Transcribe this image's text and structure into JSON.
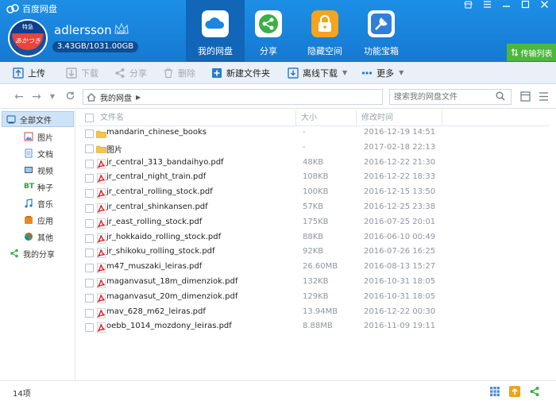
{
  "window": {
    "title": "百度网盘",
    "controls": [
      "skin-icon",
      "menu-icon",
      "minimize-icon",
      "maximize-icon",
      "close-icon"
    ]
  },
  "user": {
    "name": "adlersson",
    "badge": "VIP",
    "quota": "3.43GB/1031.00GB",
    "avatar_text_top": "特急",
    "avatar_text": "あかつき"
  },
  "nav_tabs": [
    {
      "label": "我的网盘",
      "icon": "cloud-icon",
      "active": true
    },
    {
      "label": "分享",
      "icon": "share-icon",
      "active": false
    },
    {
      "label": "隐藏空间",
      "icon": "lock-icon",
      "active": false
    },
    {
      "label": "功能宝箱",
      "icon": "tools-icon",
      "active": false
    }
  ],
  "transfer": {
    "label": "传输列表",
    "icon": "transfer-icon"
  },
  "toolbar": {
    "upload": "上传",
    "download": "下载",
    "share": "分享",
    "delete": "删除",
    "new_folder": "新建文件夹",
    "offline_download": "离线下载",
    "more": "更多"
  },
  "address": {
    "path": "我的网盘",
    "search_placeholder": "搜索我的网盘文件"
  },
  "sidebar": {
    "items": [
      {
        "label": "全部文件",
        "icon": "all-files-icon",
        "active": true
      },
      {
        "label": "图片",
        "icon": "image-icon"
      },
      {
        "label": "文档",
        "icon": "document-icon"
      },
      {
        "label": "视频",
        "icon": "video-icon"
      },
      {
        "label": "种子",
        "icon": "bt-icon",
        "badge": "BT"
      },
      {
        "label": "音乐",
        "icon": "music-icon"
      },
      {
        "label": "应用",
        "icon": "apps-icon"
      },
      {
        "label": "其他",
        "icon": "other-icon"
      },
      {
        "label": "我的分享",
        "icon": "my-share-icon"
      }
    ]
  },
  "columns": {
    "name": "文件名",
    "size": "大小",
    "modified": "修改时间"
  },
  "files": [
    {
      "name": "mandarin_chinese_books",
      "type": "folder",
      "size": "-",
      "modified": "2016-12-19 14:51"
    },
    {
      "name": "图片",
      "type": "folder",
      "size": "-",
      "modified": "2017-02-18 22:13"
    },
    {
      "name": "jr_central_313_bandaihyo.pdf",
      "type": "pdf",
      "size": "48KB",
      "modified": "2016-12-22 21:30"
    },
    {
      "name": "jr_central_night_train.pdf",
      "type": "pdf",
      "size": "108KB",
      "modified": "2016-12-22 18:33"
    },
    {
      "name": "jr_central_rolling_stock.pdf",
      "type": "pdf",
      "size": "100KB",
      "modified": "2016-12-15 13:50"
    },
    {
      "name": "jr_central_shinkansen.pdf",
      "type": "pdf",
      "size": "57KB",
      "modified": "2016-12-25 23:38"
    },
    {
      "name": "jr_east_rolling_stock.pdf",
      "type": "pdf",
      "size": "175KB",
      "modified": "2016-07-25 20:01"
    },
    {
      "name": "jr_hokkaido_rolling_stock.pdf",
      "type": "pdf",
      "size": "88KB",
      "modified": "2016-06-10 00:49"
    },
    {
      "name": "jr_shikoku_rolling_stock.pdf",
      "type": "pdf",
      "size": "92KB",
      "modified": "2016-07-26 16:25"
    },
    {
      "name": "m47_muszaki_leiras.pdf",
      "type": "pdf",
      "size": "26.60MB",
      "modified": "2016-08-13 15:27"
    },
    {
      "name": "maganvasut_18m_dimenziok.pdf",
      "type": "pdf",
      "size": "132KB",
      "modified": "2016-10-31 18:05"
    },
    {
      "name": "maganvasut_20m_dimenziok.pdf",
      "type": "pdf",
      "size": "129KB",
      "modified": "2016-10-31 18:05"
    },
    {
      "name": "mav_628_m62_leiras.pdf",
      "type": "pdf",
      "size": "13.94MB",
      "modified": "2016-12-22 00:30"
    },
    {
      "name": "oebb_1014_mozdony_leiras.pdf",
      "type": "pdf",
      "size": "8.88MB",
      "modified": "2016-11-09 19:11"
    }
  ],
  "status": {
    "count": "14项"
  },
  "colors": {
    "header": "#1a86df",
    "active_tab": "#1266b8",
    "transfer": "#4db63e",
    "folder": "#f3c54a",
    "pdf": "#d7232a"
  }
}
